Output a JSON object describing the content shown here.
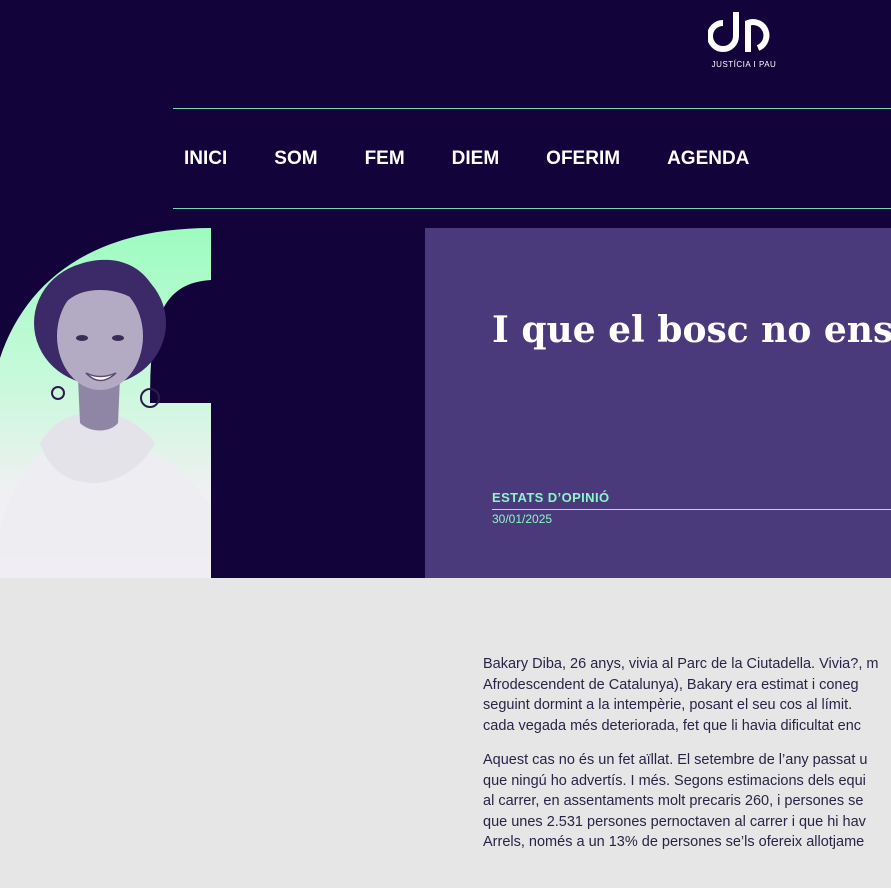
{
  "site": {
    "logo_text": "JUSTÍCIA I PAU"
  },
  "nav": {
    "items": [
      "INICI",
      "SOM",
      "FEM",
      "DIEM",
      "OFERIM",
      "AGENDA"
    ]
  },
  "article": {
    "title": "I que el bosc no ens des",
    "category": "ESTATS D’OPINIÓ",
    "date": "30/01/2025",
    "paragraphs": [
      [
        "Bakary Diba, 26 anys, vivia al Parc de la Ciutadella. Vivia?, m",
        "Afrodescendent de Catalunya), Bakary era estimat i coneg",
        "seguint dormint a la intempèrie, posant el seu cos al límit. ",
        "cada vegada més deteriorada, fet que li havia dificultat enc"
      ],
      [
        "Aquest cas no és un fet aïllat. El setembre de l’any passat u",
        "que ningú ho advertís. I més. Segons estimacions dels equi",
        "al carrer, en assentaments molt precaris 260, i persones se",
        "que unes 2.531 persones pernoctaven al carrer i que hi hav",
        "Arrels, només a un 13% de persones se’ls ofereix allotjame"
      ]
    ]
  },
  "colors": {
    "header_bg": "#12033b",
    "feature_bg": "#4a3a7c",
    "accent_green": "#8cf5c8",
    "body_bg": "#e6e6e6"
  }
}
